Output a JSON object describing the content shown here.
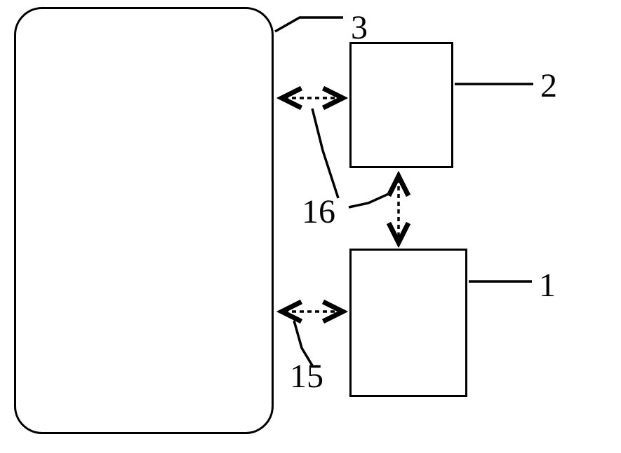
{
  "diagram": {
    "labels": {
      "block3": "3",
      "block2": "2",
      "block1": "1",
      "connection16": "16",
      "connection15": "15"
    }
  }
}
